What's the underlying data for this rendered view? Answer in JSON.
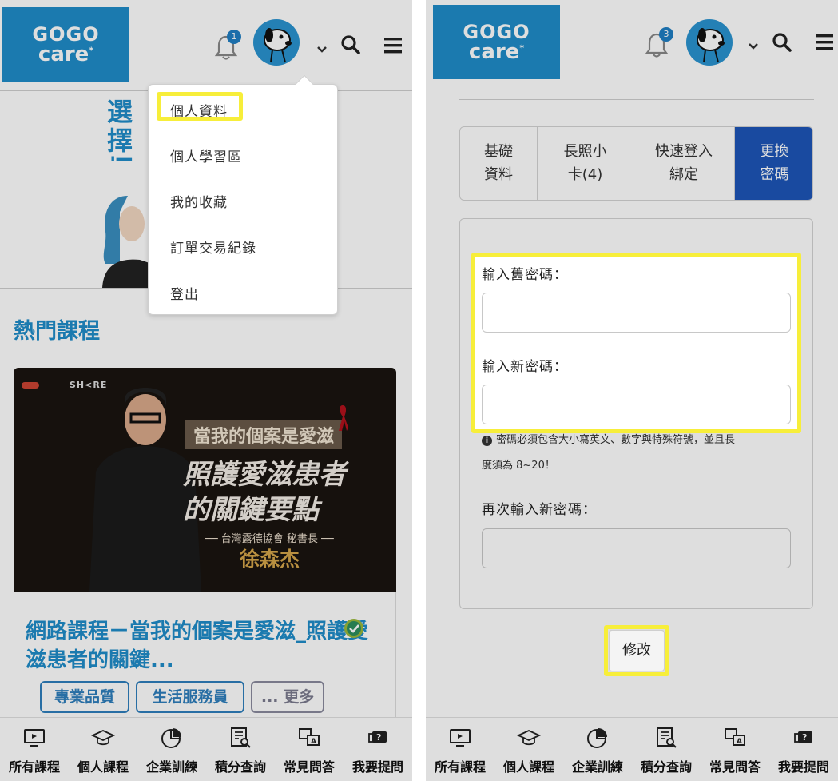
{
  "left": {
    "logo": {
      "line1": "GOGO",
      "line2": "care",
      "mark": "*"
    },
    "notification_count": "1",
    "banner_title": "選擇拓展",
    "dropdown": {
      "items": [
        {
          "label": "個人資料"
        },
        {
          "label": "個人學習區"
        },
        {
          "label": "我的收藏"
        },
        {
          "label": "訂單交易紀錄"
        },
        {
          "label": "登出"
        }
      ]
    },
    "hot_courses_title": "熱門課程",
    "course": {
      "image": {
        "brand": "SH<RE",
        "subtitle_box": "當我的個案是愛滋",
        "headline_1": "照護愛滋患者",
        "headline_2": "的關鍵要點",
        "speaker_org": "台灣露德協會 秘書長",
        "speaker_name": "徐森杰"
      },
      "title": "網路課程－當我的個案是愛滋_照護愛滋患者的關鍵...",
      "tags": [
        "專業品質",
        "生活服務員",
        "... 更多"
      ]
    }
  },
  "right": {
    "logo": {
      "line1": "GOGO",
      "line2": "care",
      "mark": "*"
    },
    "notification_count": "3",
    "tabs": [
      {
        "label_1": "基礎",
        "label_2": "資料"
      },
      {
        "label_1": "長照小",
        "label_2": "卡(4)"
      },
      {
        "label_1": "快速登入",
        "label_2": "綁定"
      },
      {
        "label_1": "更換",
        "label_2": "密碼"
      }
    ],
    "form": {
      "old_password_label": "輸入舊密碼：",
      "old_password_value": "",
      "new_password_label": "輸入新密碼：",
      "new_password_value": "",
      "hint_line1": "密碼必須包含大小寫英文、數字與特殊符號，並且長",
      "hint_line2": "度須為 8~20！",
      "confirm_password_label": "再次輸入新密碼：",
      "confirm_password_value": "",
      "submit_label": "修改"
    }
  },
  "bottom_nav": [
    {
      "label": "所有課程",
      "icon": "tv-icon"
    },
    {
      "label": "個人課程",
      "icon": "graduation-cap-icon"
    },
    {
      "label": "企業訓練",
      "icon": "pie-chart-icon"
    },
    {
      "label": "積分查詢",
      "icon": "document-search-icon"
    },
    {
      "label": "常見問答",
      "icon": "translate-chat-icon"
    },
    {
      "label": "我要提問",
      "icon": "question-chat-icon"
    }
  ],
  "colors": {
    "brand_blue": "#1f8dc9",
    "active_tab": "#1d56b8",
    "highlight": "#f7ee3a"
  }
}
